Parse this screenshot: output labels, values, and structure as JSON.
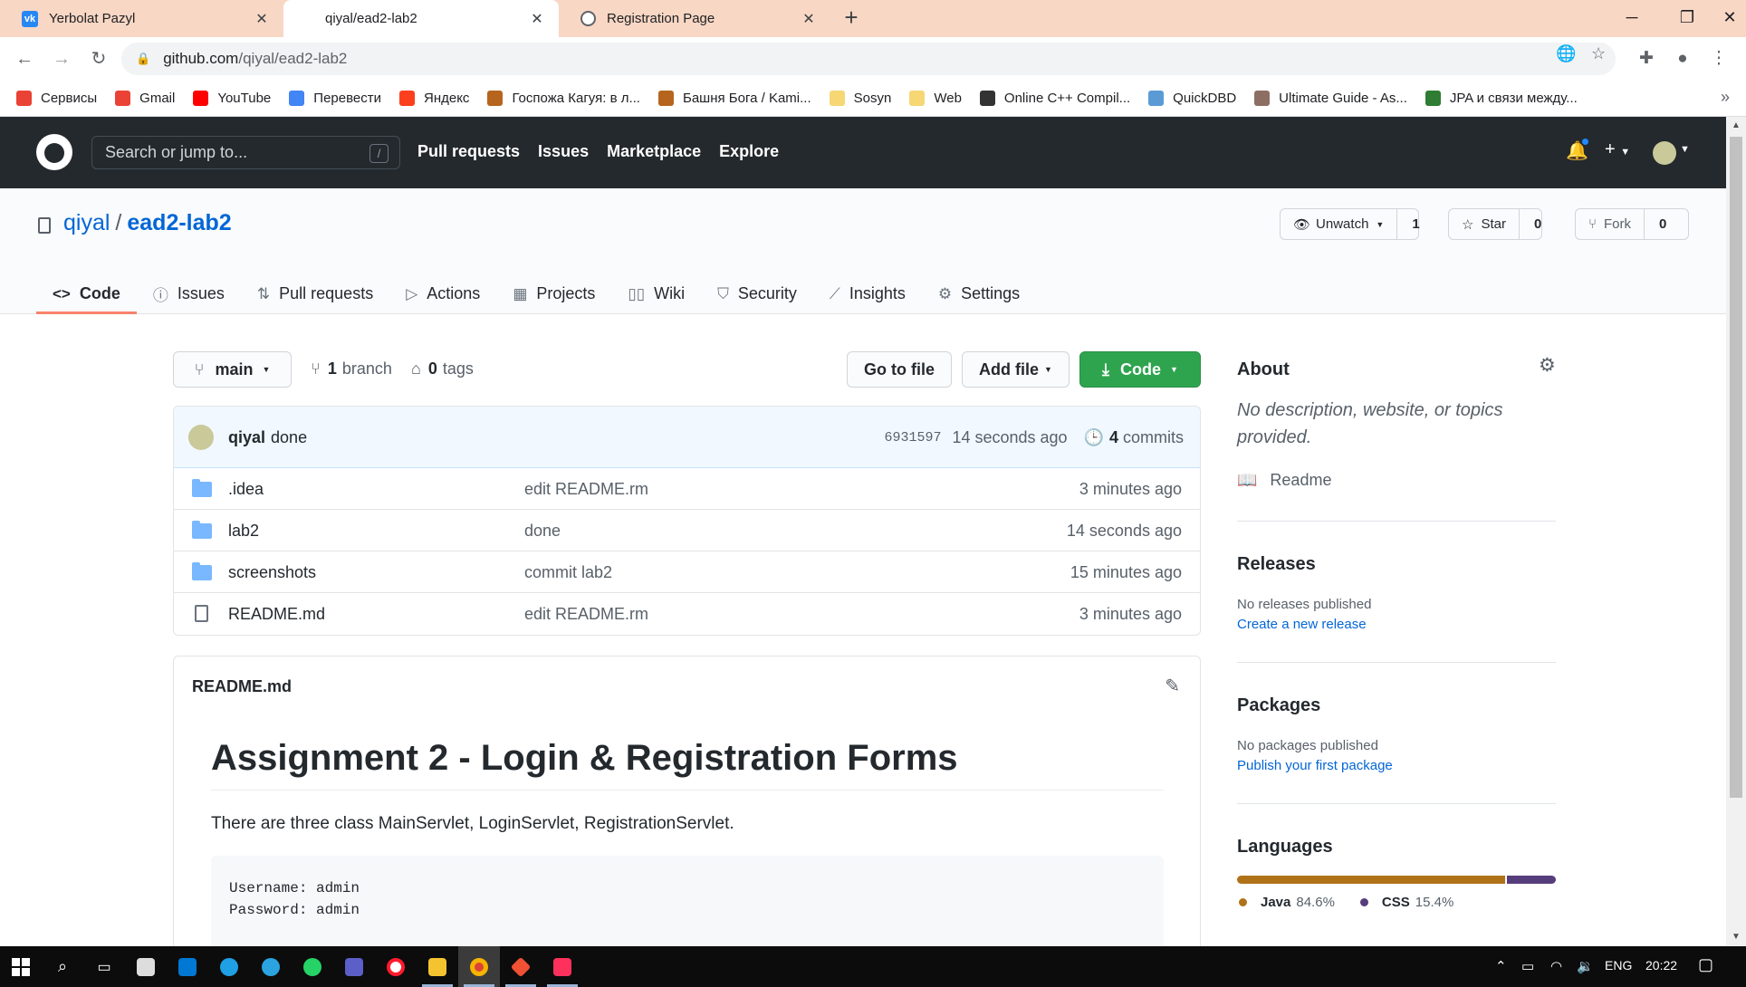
{
  "browser": {
    "tabs": [
      {
        "title": "Yerbolat Pazyl",
        "icon": "vk-icon",
        "color": "#2787f5",
        "active": false
      },
      {
        "title": "qiyal/ead2-lab2",
        "icon": "github-icon",
        "color": "#24292e",
        "active": true
      },
      {
        "title": "Registration Page",
        "icon": "globe-icon",
        "color": "#5f6368",
        "active": false
      }
    ],
    "new_tab": "+",
    "url_host": "github.com",
    "url_path": "/qiyal/ead2-lab2",
    "bookmarks": [
      {
        "label": "Сервисы",
        "color": "#ea4335"
      },
      {
        "label": "Gmail",
        "color": "#ea4335"
      },
      {
        "label": "YouTube",
        "color": "#ff0000"
      },
      {
        "label": "Перевести",
        "color": "#4285f4"
      },
      {
        "label": "Яндекс",
        "color": "#fc3f1d"
      },
      {
        "label": "Госпожа Кагуя: в л...",
        "color": "#b5651d"
      },
      {
        "label": "Башня Бога / Kami...",
        "color": "#b5651d"
      },
      {
        "label": "Sosyn",
        "color": "#f7d774"
      },
      {
        "label": "Web",
        "color": "#f7d774"
      },
      {
        "label": "Online C++ Compil...",
        "color": "#333333"
      },
      {
        "label": "QuickDBD",
        "color": "#5b9bd5"
      },
      {
        "label": "Ultimate Guide - As...",
        "color": "#8d6e63"
      },
      {
        "label": "JPA и связи между...",
        "color": "#2e7d32"
      }
    ]
  },
  "github": {
    "search_placeholder": "Search or jump to...",
    "search_key": "/",
    "nav": [
      "Pull requests",
      "Issues",
      "Marketplace",
      "Explore"
    ],
    "owner": "qiyal",
    "repo": "ead2-lab2",
    "watch": {
      "label": "Unwatch",
      "count": "1"
    },
    "star": {
      "label": "Star",
      "count": "0"
    },
    "fork": {
      "label": "Fork",
      "count": "0"
    },
    "tabs": [
      "Code",
      "Issues",
      "Pull requests",
      "Actions",
      "Projects",
      "Wiki",
      "Security",
      "Insights",
      "Settings"
    ],
    "branch": "main",
    "branch_count": "1",
    "branch_label": "branch",
    "tag_count": "0",
    "tag_label": "tags",
    "buttons": {
      "go_to_file": "Go to file",
      "add_file": "Add file",
      "code": "Code"
    },
    "commit": {
      "author": "qiyal",
      "message": "done",
      "sha": "6931597",
      "time": "14 seconds ago",
      "count": "4",
      "count_label": "commits"
    },
    "files": [
      {
        "name": ".idea",
        "type": "folder",
        "message": "edit README.rm",
        "age": "3 minutes ago"
      },
      {
        "name": "lab2",
        "type": "folder",
        "message": "done",
        "age": "14 seconds ago"
      },
      {
        "name": "screenshots",
        "type": "folder",
        "message": "commit lab2",
        "age": "15 minutes ago"
      },
      {
        "name": "README.md",
        "type": "file",
        "message": "edit README.rm",
        "age": "3 minutes ago"
      }
    ],
    "readme": {
      "filename": "README.md",
      "h1": "Assignment 2 - Login & Registration Forms",
      "paragraph": "There are three class MainServlet, LoginServlet, RegistrationServlet.",
      "code_line1": "Username: admin",
      "code_line2": "Password: admin"
    },
    "about": {
      "title": "About",
      "description": "No description, website, or topics provided.",
      "readme_link": "Readme"
    },
    "releases": {
      "title": "Releases",
      "empty": "No releases published",
      "link": "Create a new release"
    },
    "packages": {
      "title": "Packages",
      "empty": "No packages published",
      "link": "Publish your first package"
    },
    "languages": {
      "title": "Languages",
      "items": [
        {
          "name": "Java",
          "percent": "84.6%",
          "value": 84.6,
          "color": "#b07219"
        },
        {
          "name": "CSS",
          "percent": "15.4%",
          "value": 15.4,
          "color": "#563d7c"
        }
      ]
    }
  },
  "taskbar": {
    "lang": "ENG",
    "time": "20:22"
  }
}
